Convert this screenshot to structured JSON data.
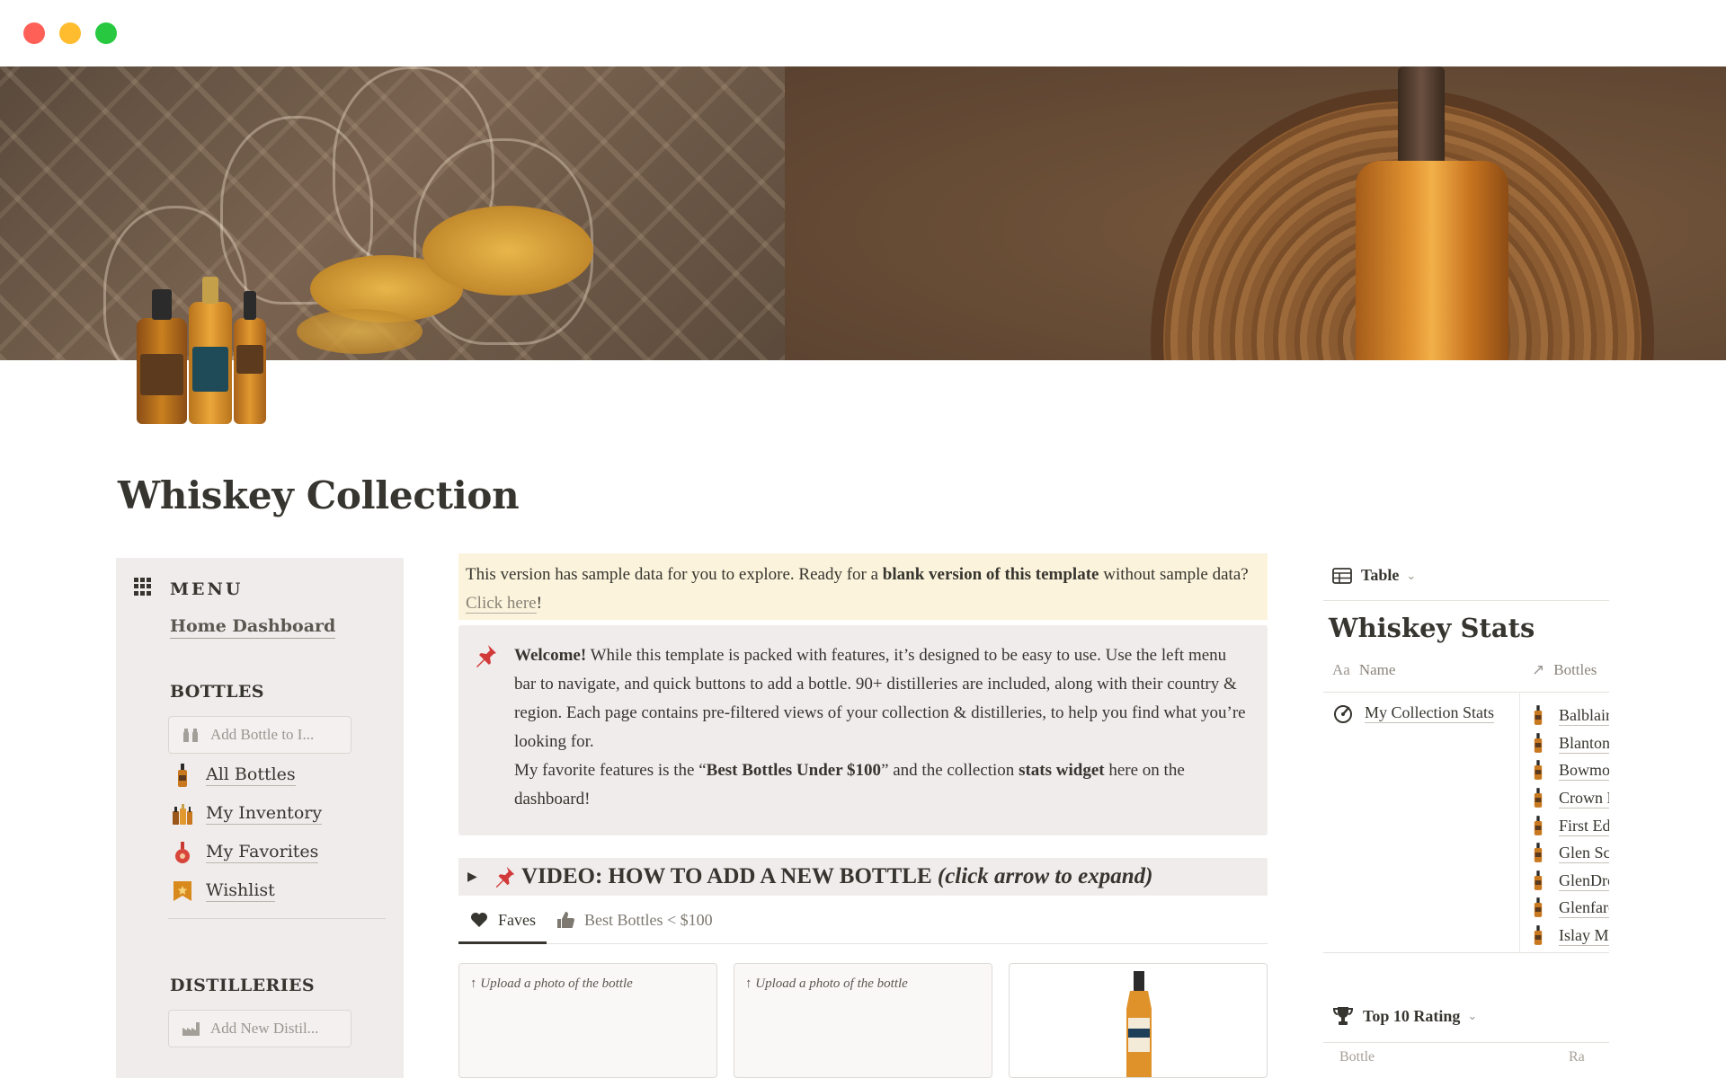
{
  "window": {
    "controls": [
      "close",
      "minimize",
      "zoom"
    ]
  },
  "page": {
    "title": "Whiskey Collection"
  },
  "menu": {
    "title": "MENU",
    "home_link": "Home Dashboard",
    "bottles": {
      "heading": "BOTTLES",
      "add_button": "Add Bottle to I...",
      "items": [
        {
          "label": "All Bottles",
          "icon": "bottle-icon"
        },
        {
          "label": "My Inventory",
          "icon": "bottles-group-icon"
        },
        {
          "label": "My Favorites",
          "icon": "favorite-bottle-icon"
        },
        {
          "label": "Wishlist",
          "icon": "bookmark-icon"
        }
      ]
    },
    "distilleries": {
      "heading": "DISTILLERIES",
      "add_button": "Add New Distil..."
    }
  },
  "notice": {
    "text_before": "This version has sample data for you to explore. Ready for a ",
    "bold": "blank version of this template",
    "text_after": " without sample data? ",
    "link": "Click here",
    "end": "!"
  },
  "callout": {
    "icon": "pushpin-icon",
    "welcome_bold": "Welcome!",
    "p1": " While this template is packed with features, it’s designed to be easy to use. Use the left menu bar to navigate, and quick buttons to add a bottle. 90+ distilleries are included, along with their country & region. Each page contains pre-filtered views of your collection & distilleries, to help you find what you’re looking for.",
    "p2_before": "My favorite features is the “",
    "p2_bold1": "Best Bottles Under $100",
    "p2_mid": "” and the collection ",
    "p2_bold2": "stats widget",
    "p2_after": " here on the dashboard!"
  },
  "video_toggle": {
    "title": "VIDEO: HOW TO ADD A NEW BOTTLE ",
    "hint": "(click arrow to expand)"
  },
  "gallery_tabs": [
    {
      "label": "Faves",
      "icon": "heart-icon",
      "active": true
    },
    {
      "label": "Best Bottles < $100",
      "icon": "thumbs-up-icon",
      "active": false
    }
  ],
  "gallery_cards": [
    {
      "upload_text": "↑ Upload a photo of the bottle"
    },
    {
      "upload_text": "↑ Upload a photo of the bottle"
    },
    {
      "upload_text": ""
    }
  ],
  "stats": {
    "view_label": "Table",
    "title": "Whiskey Stats",
    "columns": {
      "name": "Name",
      "bottles": "Bottles"
    },
    "row_name": "My Collection Stats",
    "bottles": [
      "Balblair",
      "Blanton's",
      "Bowmore",
      "Crown Royal",
      "First Edition",
      "Glen Scotia",
      "GlenDronach",
      "Glenfarclas",
      "Islay Mist"
    ]
  },
  "rating": {
    "view_label": "Top 10 Rating",
    "columns": {
      "bottle": "Bottle",
      "rating": "Ra"
    }
  },
  "colors": {
    "notice_bg": "#fbf3db",
    "callout_bg": "#f1ecec",
    "menu_bg": "#f1ecec",
    "text": "#37352f"
  }
}
